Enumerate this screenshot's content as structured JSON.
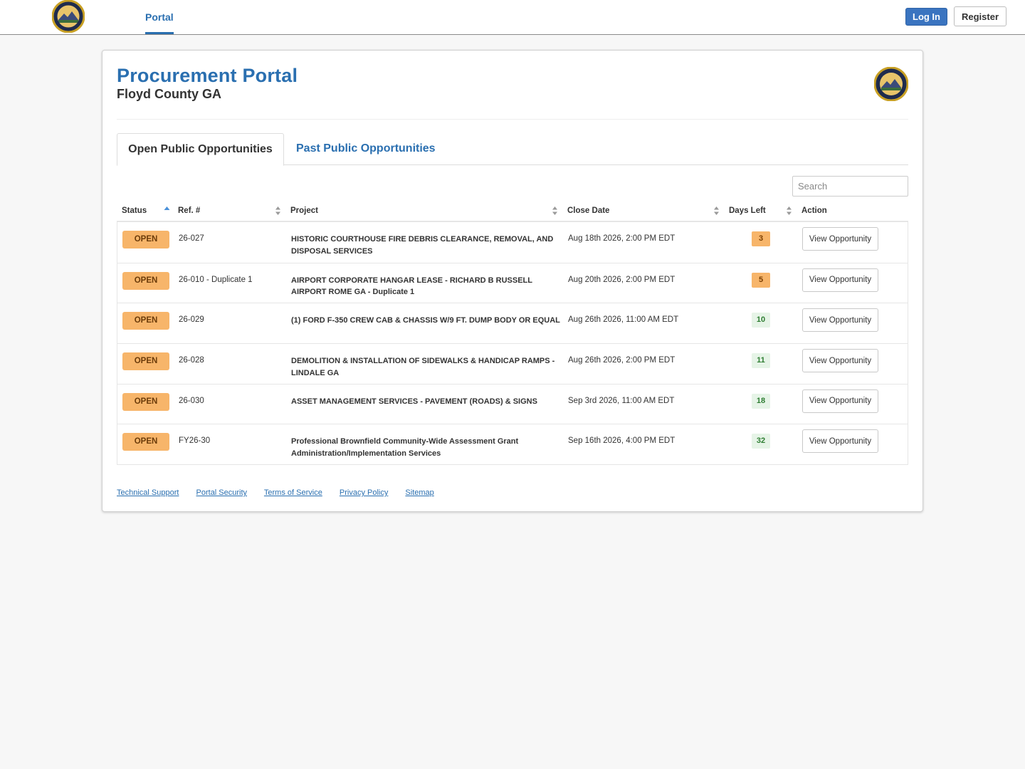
{
  "nav": {
    "portal_label": "Portal",
    "login_label": "Log In",
    "register_label": "Register"
  },
  "header": {
    "title": "Procurement Portal",
    "subtitle": "Floyd County GA"
  },
  "tabs": [
    {
      "label": "Open Public Opportunities",
      "active": true
    },
    {
      "label": "Past Public Opportunities",
      "active": false
    }
  ],
  "search": {
    "placeholder": "Search",
    "value": ""
  },
  "table": {
    "columns": [
      "Status",
      "Ref. #",
      "Project",
      "Close Date",
      "Days Left",
      "Action"
    ],
    "rows": [
      {
        "status": "OPEN",
        "ref": "26-027",
        "project": "HISTORIC COURTHOUSE FIRE DEBRIS CLEARANCE, REMOVAL, AND DISPOSAL SERVICES",
        "close_date": "Aug 18th 2026, 2:00 PM EDT",
        "days_left": "3",
        "action": "View Opportunity"
      },
      {
        "status": "OPEN",
        "ref": "26-010 - Duplicate 1",
        "project": "AIRPORT CORPORATE HANGAR LEASE - RICHARD B RUSSELL AIRPORT ROME GA - Duplicate 1",
        "close_date": "Aug 20th 2026, 2:00 PM EDT",
        "days_left": "5",
        "action": "View Opportunity"
      },
      {
        "status": "OPEN",
        "ref": "26-029",
        "project": "(1) FORD F-350 CREW CAB & CHASSIS W/9 FT. DUMP BODY OR EQUAL",
        "close_date": "Aug 26th 2026, 11:00 AM EDT",
        "days_left": "10",
        "action": "View Opportunity"
      },
      {
        "status": "OPEN",
        "ref": "26-028",
        "project": "DEMOLITION & INSTALLATION OF SIDEWALKS & HANDICAP RAMPS - LINDALE GA",
        "close_date": "Aug 26th 2026, 2:00 PM EDT",
        "days_left": "11",
        "action": "View Opportunity"
      },
      {
        "status": "OPEN",
        "ref": "26-030",
        "project": "ASSET MANAGEMENT SERVICES - PAVEMENT (ROADS) & SIGNS",
        "close_date": "Sep 3rd 2026, 11:00 AM EDT",
        "days_left": "18",
        "action": "View Opportunity"
      },
      {
        "status": "OPEN",
        "ref": "FY26-30",
        "project": "Professional Brownfield Community-Wide Assessment Grant Administration/Implementation Services",
        "close_date": "Sep 16th 2026, 4:00 PM EDT",
        "days_left": "32",
        "action": "View Opportunity"
      }
    ]
  },
  "footer": {
    "links": [
      "Technical Support",
      "Portal Security",
      "Terms of Service",
      "Privacy Policy",
      "Sitemap"
    ]
  },
  "colors": {
    "brand_blue": "#2a6fb0",
    "open_badge": "#f7b56a",
    "days_warn": "#f7b56a",
    "days_ok": "#e6f4e7"
  },
  "icons": {
    "logo": "floyd-county-seal-icon",
    "sort": "sort-arrows-icon"
  }
}
